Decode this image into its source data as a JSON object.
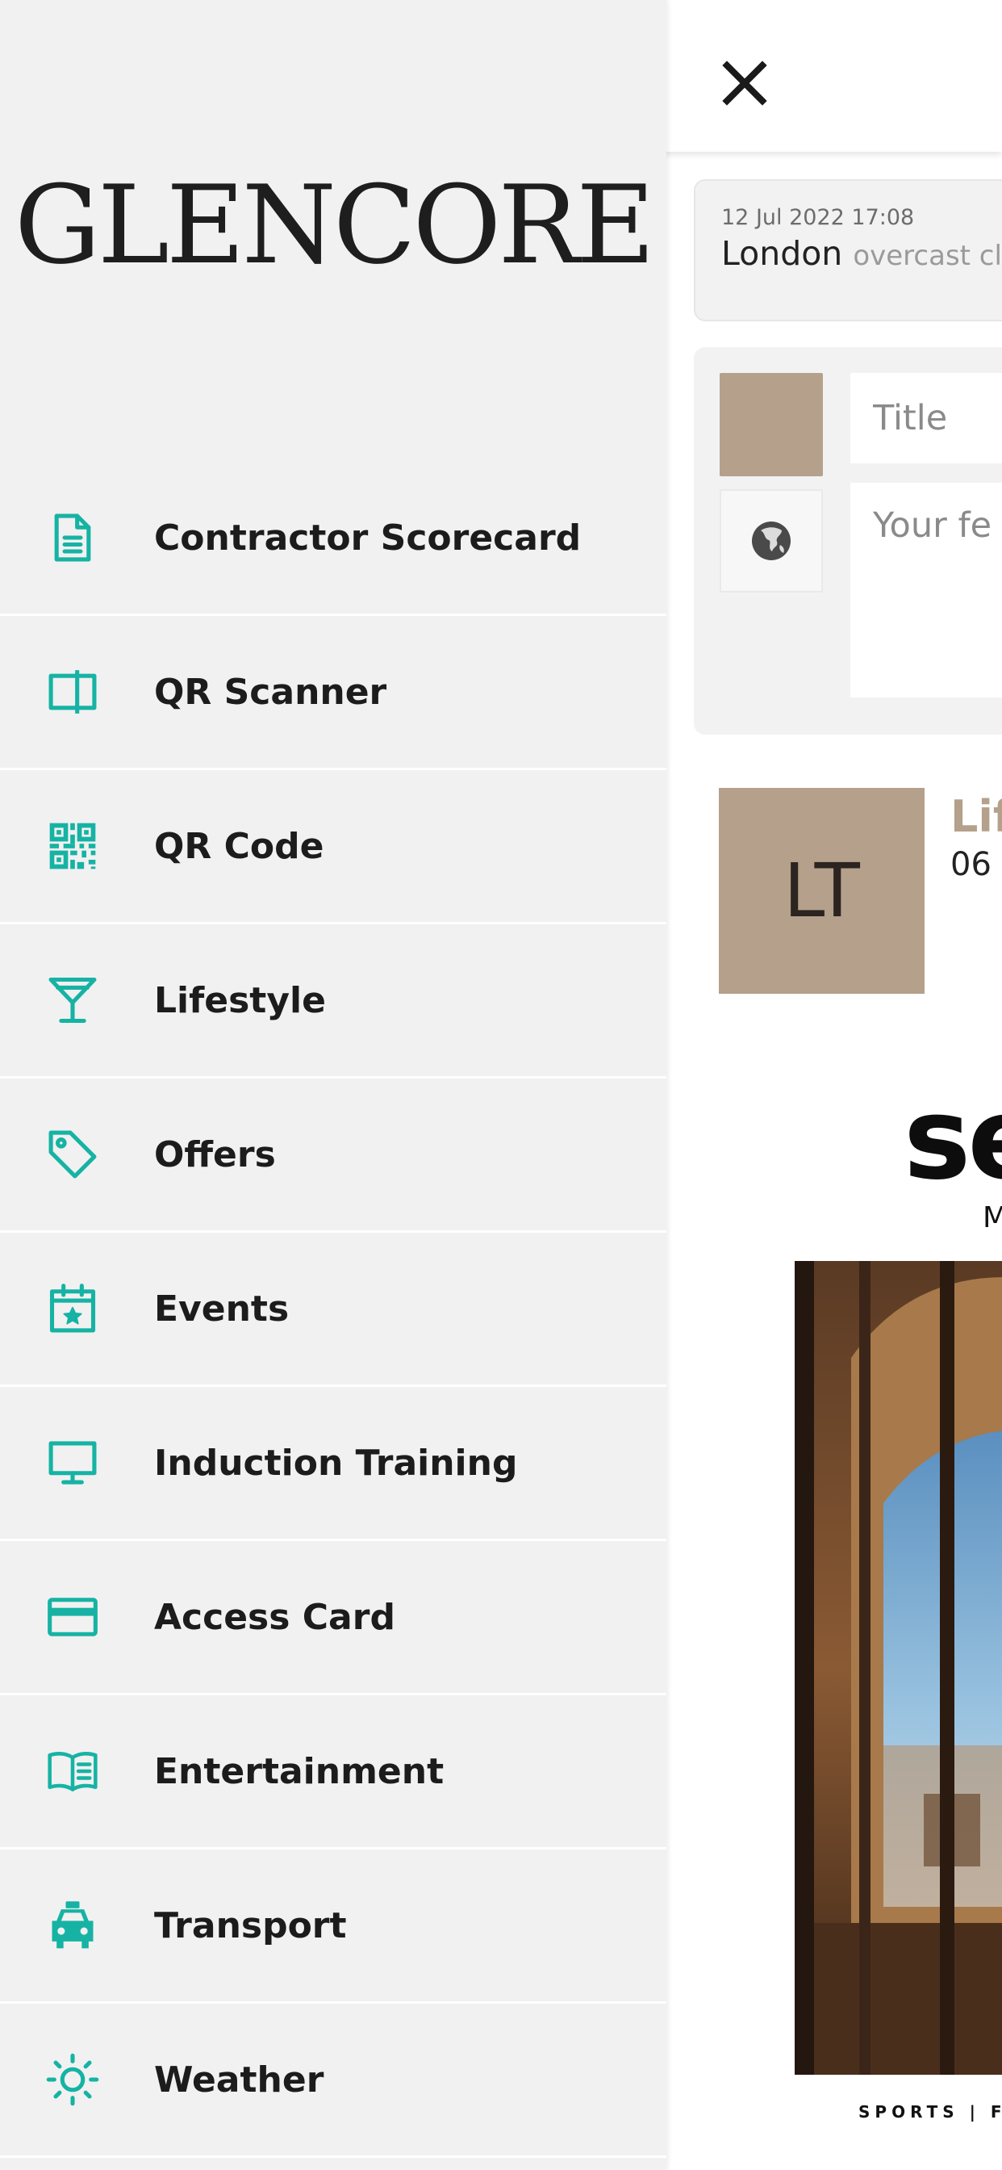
{
  "app": {
    "logo_text": "GLENCORE",
    "accent_color": "#16b3a4",
    "brand_tan": "#b5a08b"
  },
  "drawer": {
    "items": [
      {
        "label": "Contractor Scorecard",
        "icon": "document-icon"
      },
      {
        "label": "QR Scanner",
        "icon": "qr-scanner-icon"
      },
      {
        "label": "QR Code",
        "icon": "qr-code-icon"
      },
      {
        "label": "Lifestyle",
        "icon": "cocktail-icon"
      },
      {
        "label": "Offers",
        "icon": "tag-icon"
      },
      {
        "label": "Events",
        "icon": "calendar-star-icon"
      },
      {
        "label": "Induction Training",
        "icon": "monitor-icon"
      },
      {
        "label": "Access Card",
        "icon": "credit-card-icon"
      },
      {
        "label": "Entertainment",
        "icon": "book-icon"
      },
      {
        "label": "Transport",
        "icon": "taxi-icon"
      },
      {
        "label": "Weather",
        "icon": "sun-icon"
      }
    ]
  },
  "header": {
    "close_icon": "close-icon"
  },
  "weather_card": {
    "datetime": "12 Jul 2022 17:08",
    "location": "London",
    "condition": "overcast cl"
  },
  "post_form": {
    "title_placeholder": "Title",
    "feed_placeholder": "Your fe"
  },
  "news_item": {
    "avatar_initials": "LT",
    "title": "Lif",
    "date": "06"
  },
  "magazine": {
    "title": "se",
    "subtitle": "M",
    "footer": "SPORTS | F"
  }
}
